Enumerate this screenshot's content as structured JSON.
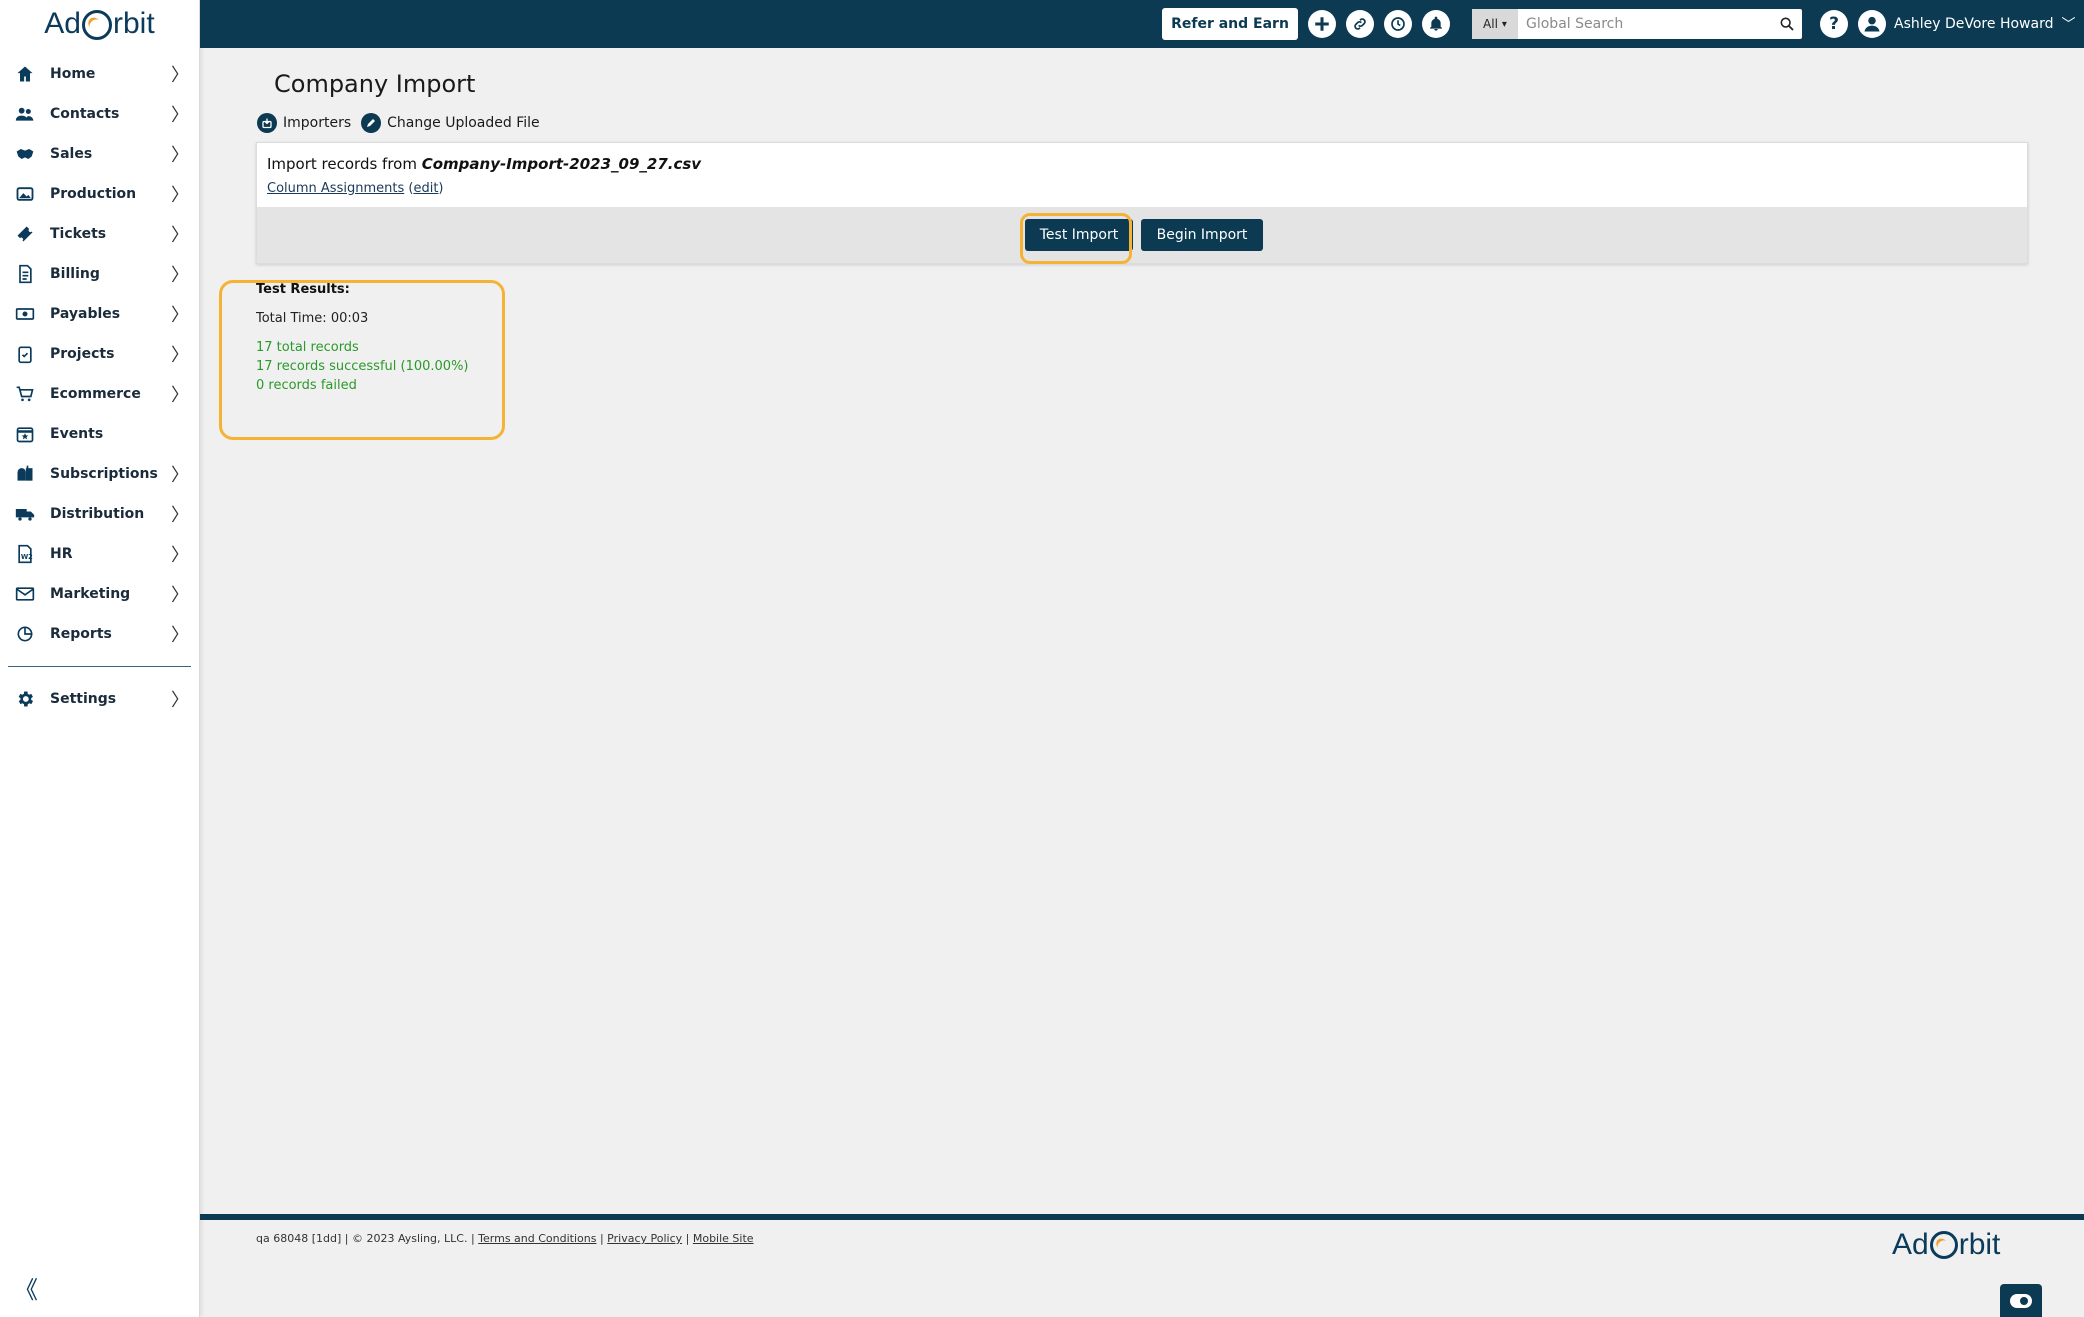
{
  "brand": {
    "logo_left": "Ad",
    "logo_right": "rbit"
  },
  "sidebar": {
    "items": [
      {
        "label": "Home",
        "icon": "home-icon",
        "has_arrow": true
      },
      {
        "label": "Contacts",
        "icon": "contacts-icon",
        "has_arrow": true
      },
      {
        "label": "Sales",
        "icon": "handshake-icon",
        "has_arrow": true
      },
      {
        "label": "Production",
        "icon": "image-icon",
        "has_arrow": true
      },
      {
        "label": "Tickets",
        "icon": "ticket-icon",
        "has_arrow": true
      },
      {
        "label": "Billing",
        "icon": "invoice-icon",
        "has_arrow": true
      },
      {
        "label": "Payables",
        "icon": "money-icon",
        "has_arrow": true
      },
      {
        "label": "Projects",
        "icon": "clipboard-check-icon",
        "has_arrow": true
      },
      {
        "label": "Ecommerce",
        "icon": "cart-icon",
        "has_arrow": true
      },
      {
        "label": "Events",
        "icon": "calendar-star-icon",
        "has_arrow": false
      },
      {
        "label": "Subscriptions",
        "icon": "mailbox-icon",
        "has_arrow": true
      },
      {
        "label": "Distribution",
        "icon": "truck-icon",
        "has_arrow": true
      },
      {
        "label": "HR",
        "icon": "w2-form-icon",
        "has_arrow": true
      },
      {
        "label": "Marketing",
        "icon": "envelope-icon",
        "has_arrow": true
      },
      {
        "label": "Reports",
        "icon": "pie-chart-icon",
        "has_arrow": true
      }
    ],
    "settings": {
      "label": "Settings",
      "icon": "gear-icon"
    },
    "collapse_glyph": "《"
  },
  "topbar": {
    "refer_label": "Refer and Earn",
    "search_scope": "All",
    "search_placeholder": "Global Search",
    "user_name": "Ashley DeVore Howard"
  },
  "page": {
    "title": "Company Import",
    "subnav": {
      "importers": "Importers",
      "change_file": "Change Uploaded File"
    },
    "import_prefix": "Import records from ",
    "file_name": "Company-Import-2023_09_27.csv",
    "column_assignments": "Column Assignments",
    "edit_open": "(",
    "edit_label": "edit",
    "edit_close": ")",
    "test_import": "Test Import",
    "begin_import": "Begin Import"
  },
  "results": {
    "heading": "Test Results:",
    "total_time": "Total Time: 00:03",
    "total_records": "17 total records",
    "successful": "17 records successful (100.00%)",
    "failed": "0 records failed"
  },
  "footer": {
    "meta": "qa 68048 [1dd] | © 2023 Aysling, LLC. | ",
    "terms": "Terms and Conditions",
    "sep1": " | ",
    "privacy": "Privacy Policy",
    "sep2": " | ",
    "mobile": "Mobile Site"
  },
  "colors": {
    "primary": "#0b3a52",
    "highlight": "#f5b335",
    "success": "#2a9a2a"
  }
}
